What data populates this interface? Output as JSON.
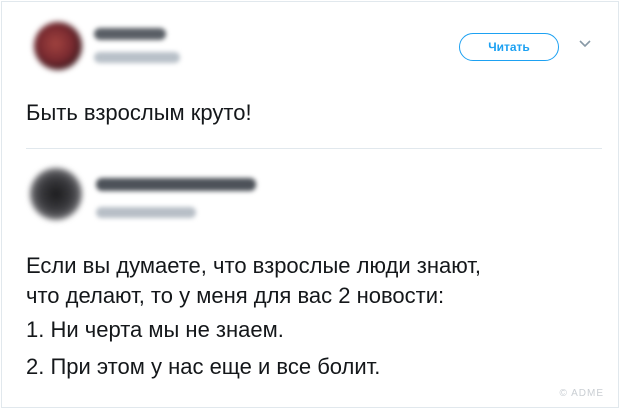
{
  "tweet1": {
    "follow_label": "Читать",
    "text": "Быть взрослым круто!"
  },
  "tweet2": {
    "lines": [
      "Если вы думаете, что взрослые люди знают,",
      "что делают, то у меня для вас 2 новости:",
      "1. Ни черта мы не знаем.",
      "2. При этом у нас еще и все болит."
    ]
  },
  "watermark": "© ADME",
  "colors": {
    "accent": "#1da1f2",
    "text": "#14171a",
    "border": "#e1e8ed"
  },
  "icons": {
    "menu": "chevron-down-icon"
  }
}
